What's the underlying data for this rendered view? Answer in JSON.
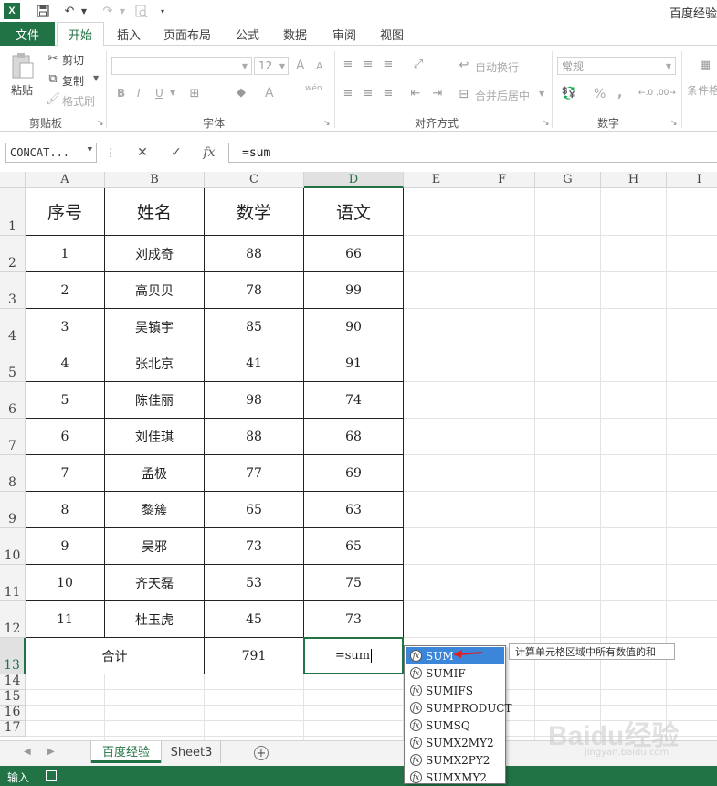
{
  "window": {
    "title": "百度经验"
  },
  "tabs": [
    "文件",
    "开始",
    "插入",
    "页面布局",
    "公式",
    "数据",
    "审阅",
    "视图"
  ],
  "active_tab": "开始",
  "ribbon": {
    "clipboard": {
      "paste": "粘贴",
      "cut": "剪切",
      "copy": "复制",
      "format_painter": "格式刷",
      "label": "剪贴板"
    },
    "font": {
      "label": "字体",
      "size": "12",
      "bold": "B",
      "italic": "I",
      "underline": "U",
      "grow": "A",
      "shrink": "A",
      "font_color": "A",
      "phonetic": "wén"
    },
    "alignment": {
      "label": "对齐方式",
      "wrap": "自动换行",
      "merge": "合并后居中"
    },
    "number": {
      "label": "数字",
      "format": "常规",
      "percent": "%",
      "comma": ","
    },
    "styles": {
      "cond_format": "条件格"
    }
  },
  "formula_bar": {
    "name_box": "CONCAT...",
    "cancel": "✕",
    "enter": "✓",
    "fx": "fx",
    "content": "=sum"
  },
  "columns": [
    "A",
    "B",
    "C",
    "D",
    "E",
    "F",
    "G",
    "H",
    "I"
  ],
  "selected_column": "D",
  "rows": [
    "1",
    "2",
    "3",
    "4",
    "5",
    "6",
    "7",
    "8",
    "9",
    "10",
    "11",
    "12",
    "13",
    "14",
    "15",
    "16",
    "17"
  ],
  "selected_row": "13",
  "table": {
    "headers": [
      "序号",
      "姓名",
      "数学",
      "语文"
    ],
    "data": [
      [
        "1",
        "刘成奇",
        "88",
        "66"
      ],
      [
        "2",
        "高贝贝",
        "78",
        "99"
      ],
      [
        "3",
        "吴镇宇",
        "85",
        "90"
      ],
      [
        "4",
        "张北京",
        "41",
        "91"
      ],
      [
        "5",
        "陈佳丽",
        "98",
        "74"
      ],
      [
        "6",
        "刘佳琪",
        "88",
        "68"
      ],
      [
        "7",
        "孟极",
        "77",
        "69"
      ],
      [
        "8",
        "黎簇",
        "65",
        "63"
      ],
      [
        "9",
        "吴邪",
        "73",
        "65"
      ],
      [
        "10",
        "齐天磊",
        "53",
        "75"
      ],
      [
        "11",
        "杜玉虎",
        "45",
        "73"
      ]
    ],
    "total_label": "合计",
    "total_math": "791",
    "editing_value": "=sum"
  },
  "autocomplete": {
    "items": [
      "SUM",
      "SUMIF",
      "SUMIFS",
      "SUMPRODUCT",
      "SUMSQ",
      "SUMX2MY2",
      "SUMX2PY2",
      "SUMXMY2"
    ],
    "selected": "SUM",
    "tooltip": "计算单元格区域中所有数值的和"
  },
  "sheets": [
    "百度经验",
    "Sheet3"
  ],
  "active_sheet": "百度经验",
  "status": {
    "mode": "输入"
  },
  "watermark": {
    "brand": "Baidu经验",
    "url": "jingyan.baidu.com"
  },
  "colors": {
    "excel_green": "#217346",
    "selection_blue": "#3b86d8"
  }
}
